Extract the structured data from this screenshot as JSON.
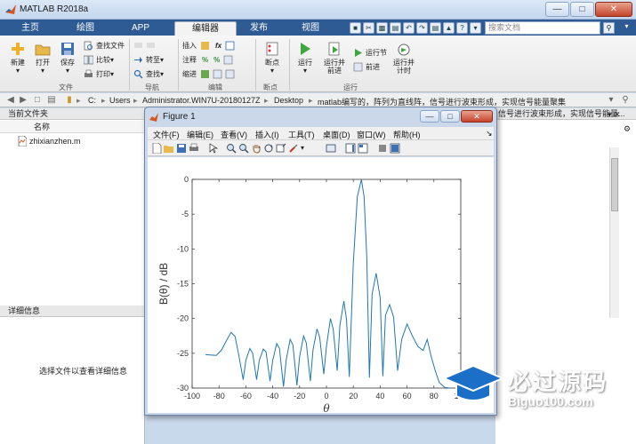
{
  "app": {
    "title": "MATLAB R2018a"
  },
  "tabs": [
    {
      "label": "主页"
    },
    {
      "label": "绘图"
    },
    {
      "label": "APP"
    },
    {
      "label": "编辑器"
    },
    {
      "label": "发布"
    },
    {
      "label": "视图"
    }
  ],
  "search": {
    "placeholder": "搜索文档"
  },
  "ribbon": {
    "file": {
      "new": "新建",
      "open": "打开",
      "save": "保存",
      "find_files": "查找文件",
      "compare": "比较",
      "print": "打印",
      "group": "文件"
    },
    "navigate": {
      "goto": "转至",
      "find": "查找",
      "group": "导航"
    },
    "edit": {
      "insert": "插入",
      "comment": "注释",
      "indent": "缩进",
      "group": "编辑"
    },
    "breakpoints": {
      "breakpoints": "断点",
      "group": "断点"
    },
    "run": {
      "run": "运行",
      "run_advance": "运行并前进",
      "run_section": "运行节",
      "advance": "前进",
      "run_time": "运行并计时",
      "group": "运行"
    }
  },
  "address": {
    "parts": [
      "C:",
      "Users",
      "Administrator.WIN7U-20180127Z",
      "Desktop",
      "matlab编写的，阵列为直线阵，信号进行波束形成，实现信号能量聚集"
    ]
  },
  "left_panel": {
    "header": "当前文件夹",
    "column_name": "名称",
    "file": "zhixianzhen.m",
    "details_header": "详细信息",
    "details_message": "选择文件以查看详细信息"
  },
  "right_panel": {
    "header": "信号进行波束形成，实现信号能量..."
  },
  "figure": {
    "title": "Figure 1",
    "menu": [
      "文件(F)",
      "编辑(E)",
      "查看(V)",
      "插入(I)",
      "工具(T)",
      "桌面(D)",
      "窗口(W)",
      "帮助(H)"
    ]
  },
  "chart_data": {
    "type": "line",
    "title": "",
    "xlabel": "θ",
    "ylabel": "B(θ) / dB",
    "xlim": [
      -100,
      100
    ],
    "ylim": [
      -30,
      0
    ],
    "xticks": [
      -100,
      -80,
      -60,
      -40,
      -20,
      0,
      20,
      40,
      60,
      80,
      100
    ],
    "yticks": [
      0,
      -5,
      -10,
      -15,
      -20,
      -25,
      -30
    ],
    "grid": false,
    "series": [
      {
        "color": "#1f77b4",
        "x": [
          -90,
          -82,
          -78,
          -74,
          -71,
          -68,
          -65,
          -62,
          -60,
          -57,
          -55,
          -52,
          -50,
          -47,
          -45,
          -42,
          -40,
          -37,
          -35,
          -32,
          -30,
          -27,
          -25,
          -22,
          -20,
          -17,
          -15,
          -12,
          -10,
          -7,
          -5,
          -2,
          0,
          3,
          5,
          8,
          10,
          13,
          15,
          17,
          20,
          23,
          26,
          28,
          30,
          32,
          34,
          37,
          40,
          42,
          44,
          47,
          50,
          53,
          56,
          60,
          64,
          68,
          72,
          75,
          78,
          81,
          84,
          88,
          92
        ],
        "y": [
          -25.2,
          -25.3,
          -24.5,
          -23.0,
          -22.0,
          -22.6,
          -25.5,
          -28.8,
          -26.0,
          -24.3,
          -25.0,
          -28.8,
          -26.0,
          -24.4,
          -24.8,
          -29.0,
          -26.0,
          -23.6,
          -24.3,
          -29.8,
          -26.0,
          -23.0,
          -23.8,
          -29.6,
          -25.5,
          -22.5,
          -23.5,
          -29.0,
          -24.5,
          -21.5,
          -22.7,
          -28.0,
          -24.0,
          -20.0,
          -21.5,
          -27.5,
          -21.0,
          -17.5,
          -20.2,
          -28.4,
          -12.0,
          -2.5,
          0.0,
          -2.5,
          -11.0,
          -28.5,
          -16.5,
          -13.5,
          -17.0,
          -28.3,
          -19.5,
          -18.0,
          -19.8,
          -27.5,
          -23.0,
          -20.8,
          -22.5,
          -24.0,
          -24.6,
          -23.0,
          -25.5,
          -27.5,
          -29.2,
          -29.9,
          -30.0
        ]
      }
    ]
  }
}
